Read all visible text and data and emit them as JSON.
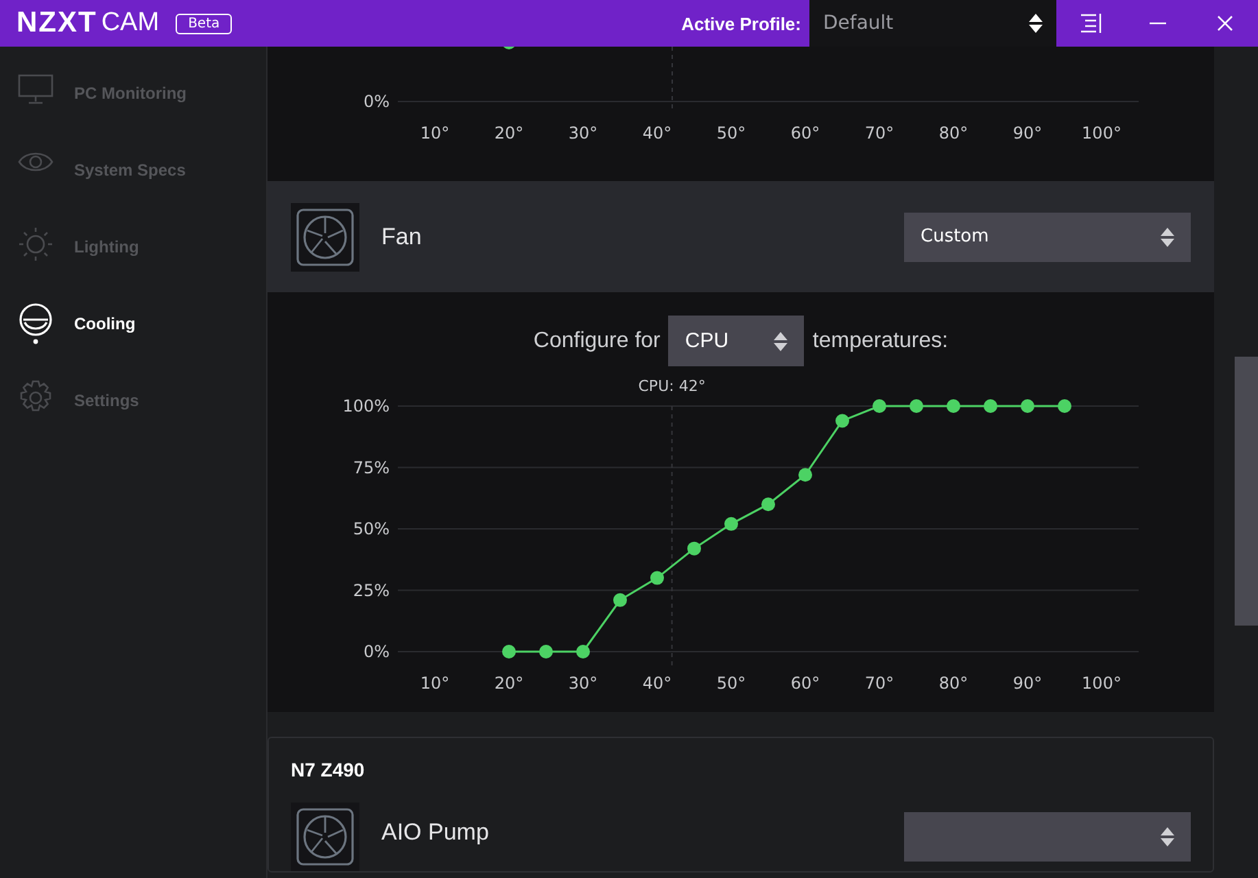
{
  "title_bar": {
    "brand": "NZXT",
    "product": "CAM",
    "badge": "Beta",
    "profile_label": "Active Profile:",
    "profile_value": "Default"
  },
  "sidebar": {
    "items": [
      {
        "label": "PC Monitoring",
        "kind": "monitor",
        "selected": false
      },
      {
        "label": "System Specs",
        "kind": "eye",
        "selected": false
      },
      {
        "label": "Lighting",
        "kind": "sun",
        "selected": false
      },
      {
        "label": "Cooling",
        "kind": "cooling",
        "selected": true
      },
      {
        "label": "Settings",
        "kind": "gear",
        "selected": false
      }
    ]
  },
  "upper_chart": {
    "y_label": "0%",
    "x_labels": [
      "10°",
      "20°",
      "30°",
      "40°",
      "50°",
      "60°",
      "70°",
      "80°",
      "90°",
      "100°"
    ]
  },
  "fan": {
    "name": "Fan",
    "mode": "Custom",
    "configure_prefix": "Configure for",
    "source": "CPU",
    "configure_suffix": "temperatures:",
    "chart_data": {
      "type": "line",
      "x": [
        20,
        25,
        30,
        35,
        40,
        45,
        50,
        55,
        60,
        65,
        70,
        75,
        80,
        85,
        90,
        95
      ],
      "grid": true,
      "series": [
        {
          "color": "#4cd264",
          "marker": "circle",
          "values": [
            0,
            0,
            0,
            21,
            30,
            42,
            52,
            60,
            72,
            94,
            100,
            100,
            100,
            100,
            100,
            100
          ]
        }
      ],
      "xlim": [
        5,
        105
      ],
      "ylim": [
        0,
        100
      ],
      "xticks": [
        {
          "value": 10,
          "label": "10°"
        },
        {
          "value": 20,
          "label": "20°"
        },
        {
          "value": 30,
          "label": "30°"
        },
        {
          "value": 40,
          "label": "40°"
        },
        {
          "value": 50,
          "label": "50°"
        },
        {
          "value": 60,
          "label": "60°"
        },
        {
          "value": 70,
          "label": "70°"
        },
        {
          "value": 80,
          "label": "80°"
        },
        {
          "value": 90,
          "label": "90°"
        },
        {
          "value": 100,
          "label": "100°"
        }
      ],
      "yticks": [
        {
          "value": 0,
          "label": "0%"
        },
        {
          "value": 25,
          "label": "25%"
        },
        {
          "value": 50,
          "label": "50%"
        },
        {
          "value": 75,
          "label": "75%"
        },
        {
          "value": 100,
          "label": "100%"
        }
      ],
      "ref_lines": [
        {
          "axis": "x",
          "value": 42,
          "label": "CPU: 42°"
        }
      ]
    }
  },
  "device": {
    "name": "N7 Z490",
    "channel": "AIO Pump"
  }
}
